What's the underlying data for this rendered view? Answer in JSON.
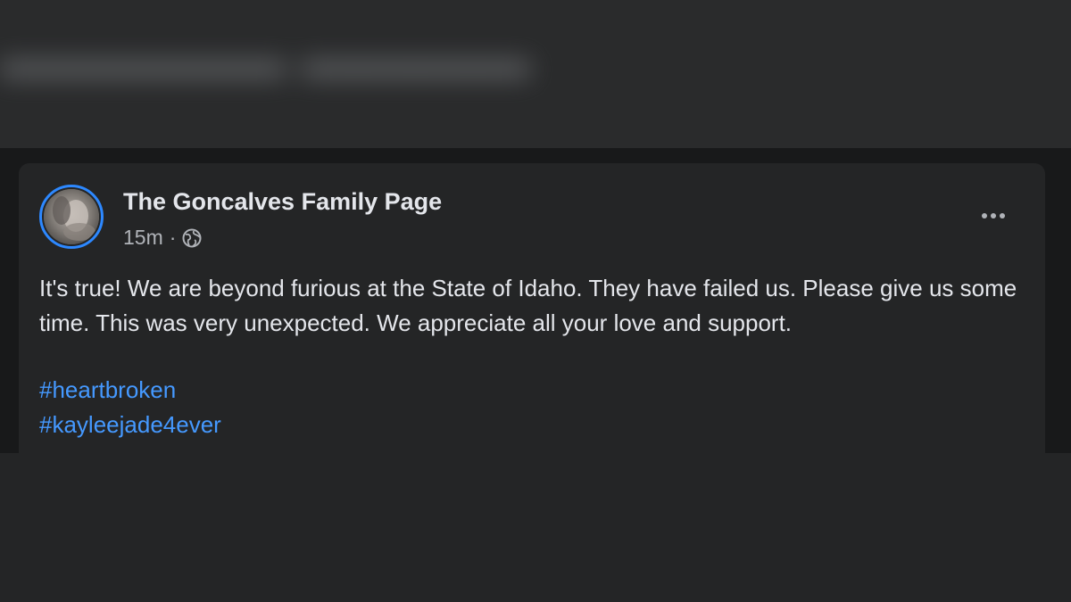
{
  "post": {
    "author_name": "The Goncalves Family Page",
    "timestamp": "15m",
    "separator": "·",
    "audience_icon": "globe-icon",
    "body": "It's true! We are beyond furious at the State of Idaho. They have failed us. Please give us some time. This was very unexpected. We appreciate all your love and support.",
    "hashtags": [
      "#heartbroken",
      "#kayleejade4ever"
    ],
    "more_icon": "more-options-icon"
  },
  "colors": {
    "background": "#242526",
    "feed_background": "#18191a",
    "text_primary": "#e4e6eb",
    "text_secondary": "#b0b3b8",
    "hashtag": "#4599ff",
    "avatar_ring": "#2d88ff"
  }
}
